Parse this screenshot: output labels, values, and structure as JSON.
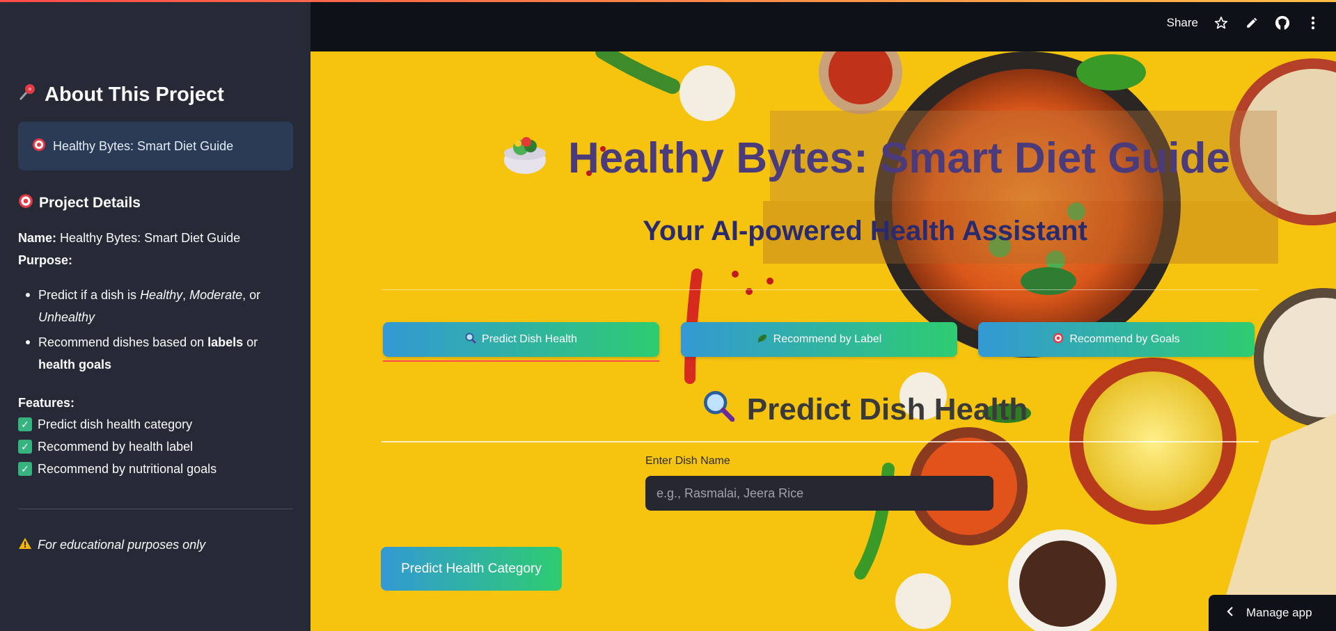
{
  "sidebar": {
    "title": "About This Project",
    "title_icon": "pushpin-icon",
    "card_text": "Healthy Bytes: Smart Diet Guide",
    "card_icon": "target-icon",
    "details_heading": "Project Details",
    "details_icon": "target-icon",
    "name_label": "Name:",
    "name_value": "Healthy Bytes: Smart Diet Guide",
    "purpose_label": "Purpose:",
    "purpose_items": [
      {
        "prefix": "Predict if a dish is ",
        "em1": "Healthy",
        "sep1": ", ",
        "em2": "Moderate",
        "sep2": ", or",
        "em3": "Unhealthy"
      },
      {
        "prefix": "Recommend dishes based on ",
        "strong1": "labels",
        "mid": " or",
        "strong2": "health goals"
      }
    ],
    "features_label": "Features:",
    "features": [
      "Predict dish health category",
      "Recommend by health label",
      "Recommend by nutritional goals"
    ],
    "disclaimer": "For educational purposes only",
    "disclaimer_icon": "warning-icon"
  },
  "header": {
    "share_label": "Share",
    "icons": [
      "star-icon",
      "edit-icon",
      "github-icon",
      "more-icon"
    ]
  },
  "main": {
    "title": "Healthy Bytes: Smart Diet Guide",
    "title_icon": "salad-bowl-icon",
    "subtitle": "Your AI-powered Health Assistant",
    "tabs": [
      {
        "label": "Predict Dish Health",
        "icon": "magnifier-icon"
      },
      {
        "label": "Recommend by Label",
        "icon": "leaf-icon"
      },
      {
        "label": "Recommend by Goals",
        "icon": "target-icon"
      }
    ],
    "section_title": "Predict Dish Health",
    "section_icon": "magnifier-icon",
    "input_label": "Enter Dish Name",
    "input_placeholder": "e.g., Rasmalai, Jeera Rice",
    "input_value": "",
    "predict_button": "Predict Health Category"
  },
  "footer": {
    "manage_label": "Manage app"
  },
  "colors": {
    "accent_gradient_start": "#3399d4",
    "accent_gradient_end": "#2ecc71",
    "sidebar_bg": "#262a36",
    "main_bg": "#f6c40f",
    "title_color": "#4b3b7a"
  }
}
